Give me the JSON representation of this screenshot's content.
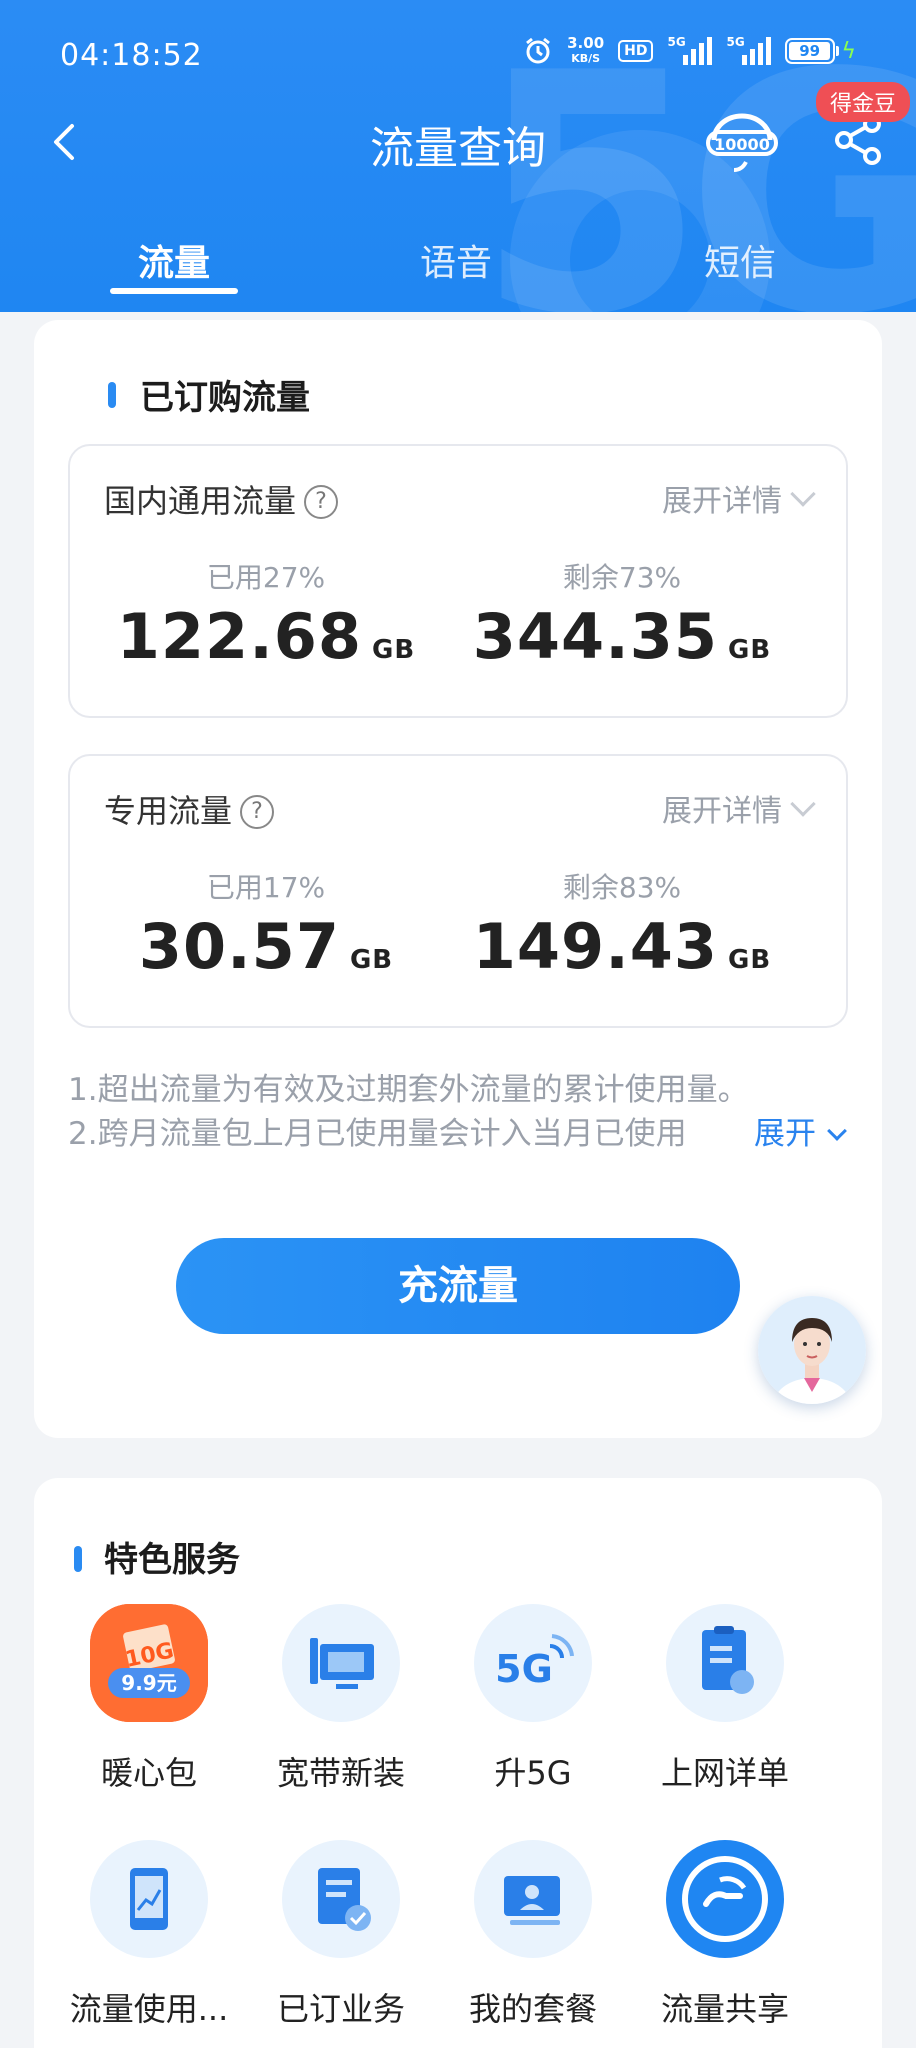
{
  "status_bar": {
    "time": "04:18:52",
    "net_speed_value": "3.00",
    "net_speed_unit": "KB/S",
    "hd_label": "HD",
    "sim1_label": "5G",
    "sim2_label": "5G",
    "battery": "99"
  },
  "header": {
    "title": "流量查询",
    "gold_badge": "得金豆",
    "hotline_icon": "10000-hotline-icon",
    "tabs": [
      {
        "label": "流量",
        "active": true
      },
      {
        "label": "语音",
        "active": false
      },
      {
        "label": "短信",
        "active": false
      }
    ]
  },
  "subscribed": {
    "section_title": "已订购流量",
    "expand_detail": "展开详情",
    "domestic": {
      "name": "国内通用流量",
      "used_label": "已用27%",
      "used_value": "122.68",
      "remain_label": "剩余73%",
      "remain_value": "344.35",
      "unit": "GB"
    },
    "dedicated": {
      "name": "专用流量",
      "used_label": "已用17%",
      "used_value": "30.57",
      "remain_label": "剩余83%",
      "remain_value": "149.43",
      "unit": "GB"
    },
    "notes": [
      "1.超出流量为有效及过期套外流量的累计使用量。",
      "2.跨月流量包上月已使用量会计入当月已使用"
    ],
    "expand_link": "展开",
    "recharge_button": "充流量"
  },
  "services": {
    "section_title": "特色服务",
    "items": [
      {
        "label": "暖心包",
        "icon": "gift-box-icon",
        "badge_top": "10G",
        "badge_bottom": "9.9元"
      },
      {
        "label": "宽带新装",
        "icon": "broadband-monitor-icon"
      },
      {
        "label": "升5G",
        "icon": "5g-signal-icon",
        "icon_text": "5G"
      },
      {
        "label": "上网详单",
        "icon": "clipboard-bill-icon"
      },
      {
        "label": "流量使用...",
        "icon": "phone-chart-icon"
      },
      {
        "label": "已订业务",
        "icon": "document-check-icon"
      },
      {
        "label": "我的套餐",
        "icon": "id-card-icon"
      },
      {
        "label": "流量共享",
        "icon": "share-hand-icon"
      }
    ]
  },
  "colors": {
    "brand_blue": "#1f86f2",
    "badge_red": "#ef4f55",
    "link_blue": "#2a83ee"
  }
}
